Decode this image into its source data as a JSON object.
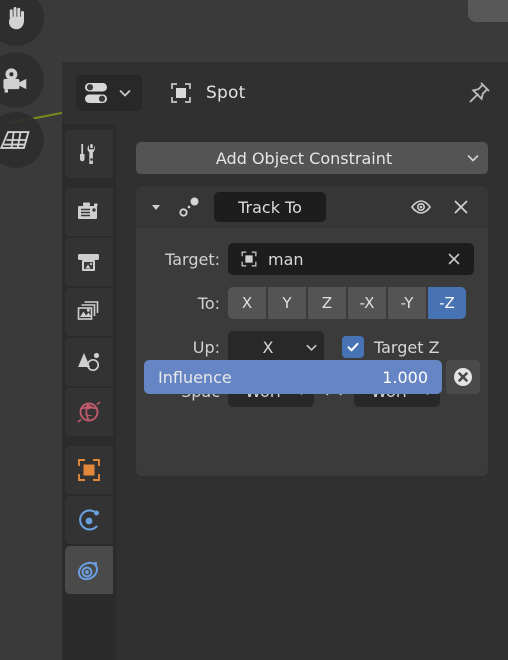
{
  "app": {
    "editor": "properties-editor",
    "theme": "blender-dark"
  },
  "viewport": {
    "gizmos": [
      {
        "name": "pan-view-gizmo",
        "icon": "hand-icon"
      },
      {
        "name": "camera-view-gizmo",
        "icon": "camera-icon"
      },
      {
        "name": "toggle-orthographic-gizmo",
        "icon": "grid-icon"
      }
    ]
  },
  "header": {
    "editor_type_icon": "properties-editor-icon",
    "editor_type_chevron": "chevron-down-icon",
    "breadcrumb_icon": "object-icon",
    "breadcrumb_label": "Spot",
    "pin_icon": "pin-icon"
  },
  "tabs": [
    {
      "id": "tool",
      "label": "Tool",
      "icon": "wrench-screwdriver-icon",
      "active": false
    },
    {
      "id": "render",
      "label": "Render",
      "icon": "camera-back-icon",
      "active": false
    },
    {
      "id": "output",
      "label": "Output",
      "icon": "printer-icon",
      "active": false
    },
    {
      "id": "view-layer",
      "label": "View Layer",
      "icon": "images-icon",
      "active": false
    },
    {
      "id": "scene",
      "label": "Scene",
      "icon": "cone-sphere-icon",
      "active": false
    },
    {
      "id": "world",
      "label": "World",
      "icon": "globe-icon",
      "active": false
    },
    {
      "id": "object",
      "label": "Object",
      "icon": "orange-square-icon",
      "active": false
    },
    {
      "id": "modifiers",
      "label": "Modifiers",
      "icon": "physics-orbit-icon",
      "active": false
    },
    {
      "id": "constraints",
      "label": "Object Constraints",
      "icon": "constraint-icon",
      "active": true
    }
  ],
  "main": {
    "add_constraint": {
      "label": "Add Object Constraint",
      "chevron": "chevron-down-icon"
    },
    "constraint": {
      "expand_icon": "triangle-down-icon",
      "type_icon": "track-to-icon",
      "name": "Track To",
      "visibility_icon": "eye-icon",
      "delete_icon": "close-x-icon",
      "target": {
        "label": "Target:",
        "object_icon": "object-icon",
        "value": "man",
        "clear_icon": "close-x-icon"
      },
      "to": {
        "label": "To:",
        "options": [
          "X",
          "Y",
          "Z",
          "-X",
          "-Y",
          "-Z"
        ],
        "selected": "-Z"
      },
      "up": {
        "label": "Up:",
        "value": "X",
        "chevron": "chevron-down-icon",
        "target_z": {
          "label": "Target Z",
          "checked": true,
          "check_icon": "check-icon"
        }
      },
      "space": {
        "label": "Spac",
        "owner_value": "Worl",
        "owner_chevron": "chevron-down-icon",
        "swap_icon": "left-right-arrows-icon",
        "target_value": "Worl",
        "target_chevron": "chevron-down-icon"
      },
      "influence": {
        "label": "Influence",
        "value": "1.000",
        "fraction": 1.0,
        "animate_icon": "decorate-override-icon"
      }
    }
  },
  "colors": {
    "accent_blue": "#4772b3",
    "slider_blue": "#6585c4",
    "panel_bg": "#3b3b3b",
    "editor_bg": "#303030",
    "tabcol_bg": "#2b2b2b",
    "field_bg": "#1d1d1d",
    "button_bg": "#545454",
    "axis_green": "#7a8c1d",
    "object_orange": "#e3883b",
    "world_red": "#c05a6a"
  }
}
